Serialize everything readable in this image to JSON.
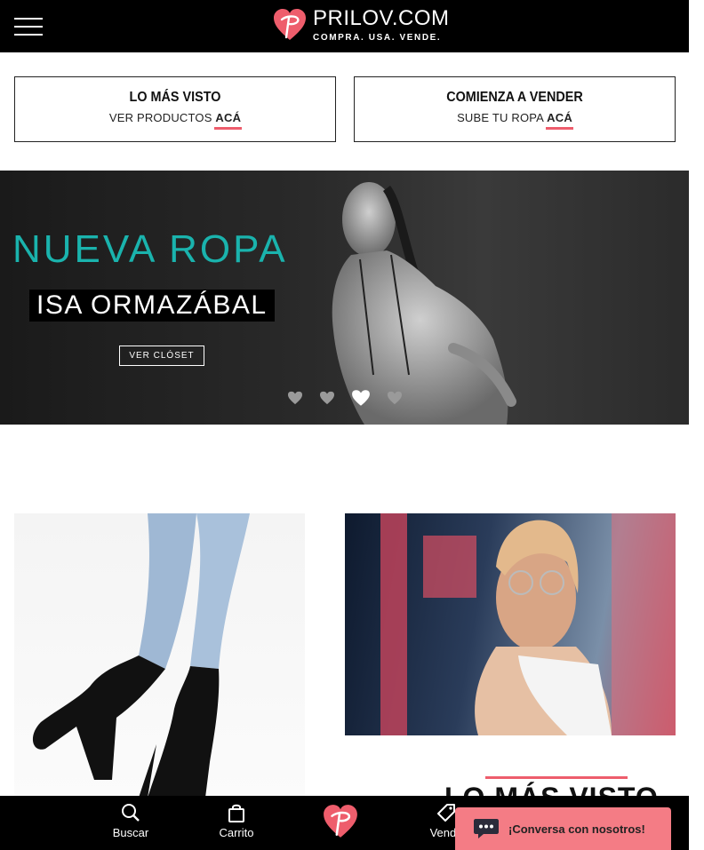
{
  "header": {
    "menu_icon": "hamburger-menu-icon",
    "logo_name": "PRILOV.COM",
    "logo_tagline": "COMPRA. USA. VENDE.",
    "brand_color": "#ee5d6c"
  },
  "cta": [
    {
      "title": "LO MÁS VISTO",
      "sub_prefix": "VER PRODUCTOS ",
      "sub_link": "ACÁ"
    },
    {
      "title": "COMIENZA A VENDER",
      "sub_prefix": "SUBE TU ROPA ",
      "sub_link": "ACÁ"
    }
  ],
  "banner": {
    "title": "NUEVA ROPA",
    "name": "ISA ORMAZÁBAL",
    "button": "VER CLÓSET",
    "title_color": "#1ab3ad",
    "slides": 4,
    "active_slide": 3
  },
  "section": {
    "title": "LO MÁS VISTO"
  },
  "bottom_nav": {
    "search": "Buscar",
    "cart": "Carrito",
    "sell": "Vende"
  },
  "chat": {
    "label": "¡Conversa con nosotros!",
    "color": "#f47c85"
  }
}
